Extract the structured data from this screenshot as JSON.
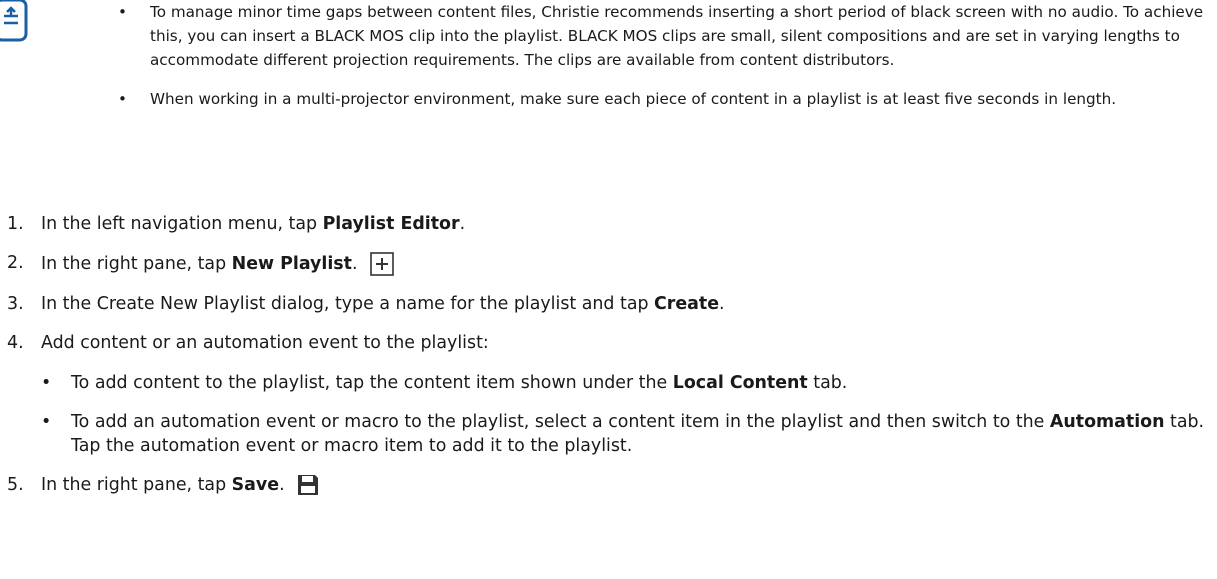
{
  "note": {
    "icon": "note-icon",
    "items": [
      "To manage minor time gaps between content files, Christie recommends inserting a short period of black screen with no audio. To achieve this, you can insert a BLACK MOS clip into the playlist. BLACK MOS clips are small, silent compositions and are set in varying lengths to accommodate different projection requirements. The clips are available from content distributors.",
      "When working in a multi-projector environment, make sure each piece of content in a playlist is at least five seconds in length."
    ]
  },
  "steps": [
    {
      "num": "1.",
      "pre": "In the left navigation menu, tap ",
      "bold": "Playlist Editor",
      "post": "."
    },
    {
      "num": "2.",
      "pre": "In the right pane, tap ",
      "bold": "New Playlist",
      "post": ".",
      "icon": "new-playlist-icon"
    },
    {
      "num": "3.",
      "pre": "In the Create New Playlist dialog, type a name for the playlist and tap ",
      "bold": "Create",
      "post": "."
    },
    {
      "num": "4.",
      "text": "Add content or an automation event to the playlist:",
      "subitems": [
        {
          "pre": "To add content to the playlist, tap the content item shown under the ",
          "bold": "Local Content",
          "post": " tab."
        },
        {
          "pre": "To add an automation event or macro to the playlist, select a content item in the playlist and then switch to the ",
          "bold": "Automation",
          "post": " tab. Tap the automation event or macro item to add it to the playlist."
        }
      ]
    },
    {
      "num": "5.",
      "pre": "In the right pane, tap ",
      "bold": "Save",
      "post": ".",
      "icon": "save-icon"
    }
  ],
  "bullet_glyph": "•"
}
